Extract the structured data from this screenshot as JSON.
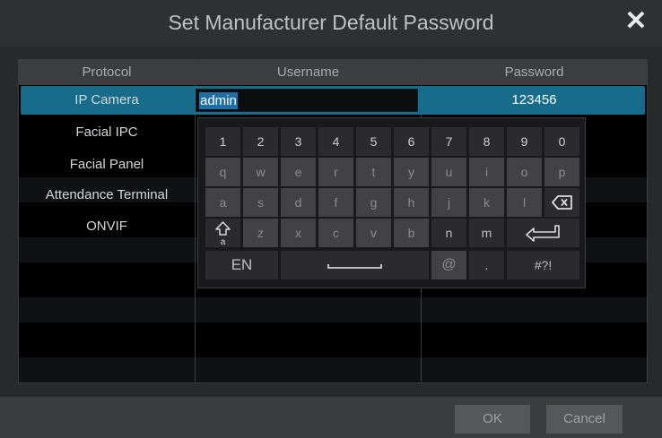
{
  "dialog": {
    "title": "Set Manufacturer Default Password",
    "close_glyph": "✕"
  },
  "table": {
    "headers": {
      "protocol": "Protocol",
      "username": "Username",
      "password": "Password"
    },
    "protocols": [
      "IP Camera",
      "Facial IPC",
      "Facial Panel",
      "Attendance Terminal",
      "ONVIF"
    ],
    "selected_protocol": "IP Camera",
    "username_value": "admin",
    "password_value": "123456"
  },
  "keyboard": {
    "row1": [
      "1",
      "2",
      "3",
      "4",
      "5",
      "6",
      "7",
      "8",
      "9",
      "0"
    ],
    "row2": [
      "q",
      "w",
      "e",
      "r",
      "t",
      "y",
      "u",
      "i",
      "o",
      "p"
    ],
    "row3": [
      "a",
      "s",
      "d",
      "f",
      "g",
      "h",
      "j",
      "k",
      "l"
    ],
    "row4": [
      "z",
      "x",
      "c",
      "v",
      "b",
      "n",
      "m"
    ],
    "lang_label": "EN",
    "at_key": "@",
    "dot_key": ".",
    "symbols_label": "#?!",
    "icons": {
      "backspace": "backspace-icon",
      "enter": "enter-icon",
      "shift": "shift-icon",
      "space": "space-icon"
    }
  },
  "footer": {
    "ok_label": "OK",
    "cancel_label": "Cancel"
  },
  "colors": {
    "selection": "#176c8b",
    "text_highlight": "#1f6fa6"
  }
}
